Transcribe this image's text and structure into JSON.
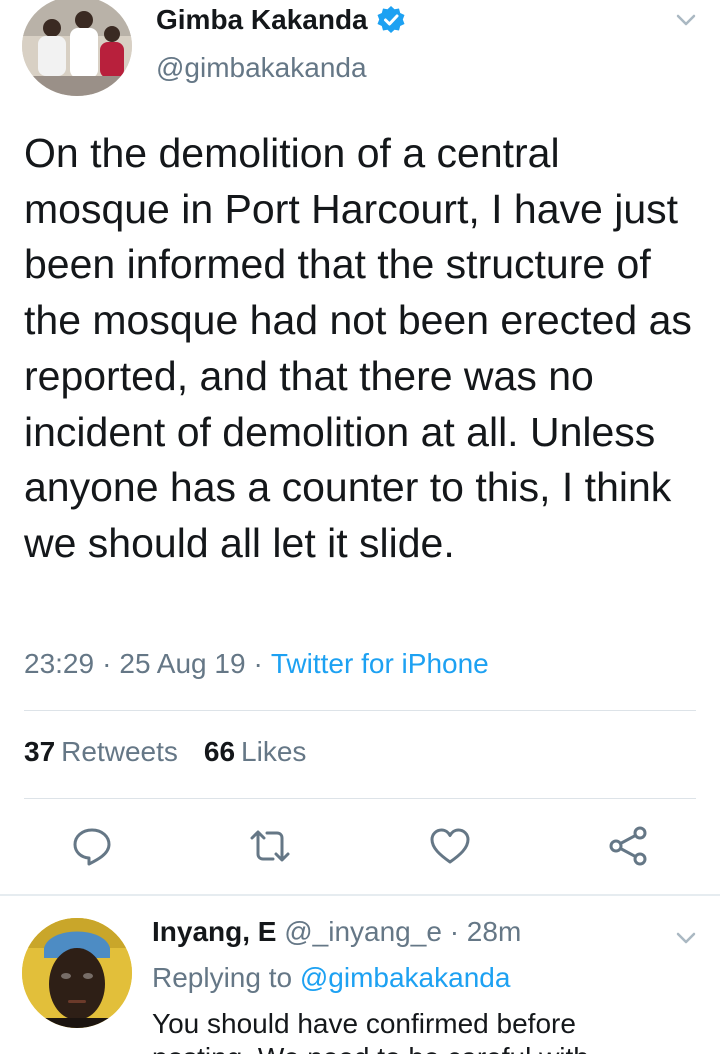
{
  "tweet": {
    "name": "Gimba Kakanda",
    "handle": "@gimbakakanda",
    "verified": true,
    "text": "On the demolition of a central mosque in Port Harcourt, I have just been informed that the structure of the mosque had not been erected as reported, and that there was no incident of demolition at all. Unless anyone has a counter to this, I think we should all let it slide.",
    "time": "23:29",
    "separator": "·",
    "date": "25 Aug 19",
    "source": "Twitter for iPhone",
    "retweets_count": "37",
    "retweets_label": "Retweets",
    "likes_count": "66",
    "likes_label": "Likes"
  },
  "actions": [
    "reply-icon",
    "retweet-icon",
    "like-icon",
    "share-icon"
  ],
  "reply": {
    "name": "Inyang, E",
    "handle": "@_inyang_e",
    "separator": "·",
    "age": "28m",
    "replying_prefix": "Replying to",
    "replying_to": "@gimbakakanda",
    "text": "You should have confirmed before",
    "text_cut": "posting. We need to be careful with"
  },
  "colors": {
    "text": "#14171a",
    "secondary": "#657786",
    "accent": "#1da1f2",
    "icon": "#657786"
  }
}
